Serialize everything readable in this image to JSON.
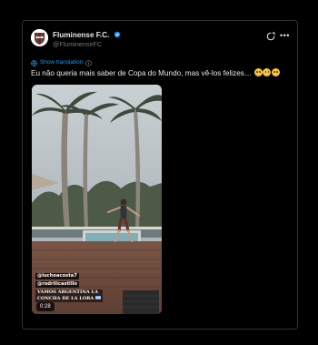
{
  "author": {
    "name": "Fluminense F.C.",
    "handle": "@FluminenseFC",
    "verified": true
  },
  "icons": {
    "verified": "verified-badge-icon",
    "x_logo": "x-logo-icon",
    "more": "more-options-icon",
    "globe": "globe-icon",
    "info": "info-icon",
    "emoji": "sweat-smile-emoji"
  },
  "translate": {
    "label": "Show translation"
  },
  "tweet": {
    "text": "Eu não queria mais saber de Copa do Mundo, mas vê-los felizes…",
    "emoji_count": 3
  },
  "media": {
    "tag_1": "@luchoacosta7",
    "tag_2": "@rodriiicastillo",
    "caption_line_1": "VAMOS ARGENTINA LA",
    "caption_line_2": "CONCHA DE LA LORA",
    "duration": "0:28"
  },
  "colors": {
    "background": "#000000",
    "text_primary": "#e7e9ea",
    "text_secondary": "#71767b",
    "link": "#1d9bf0",
    "border": "#2f3336",
    "club_maroon": "#7b1d2a",
    "club_green": "#1f6b3a"
  }
}
